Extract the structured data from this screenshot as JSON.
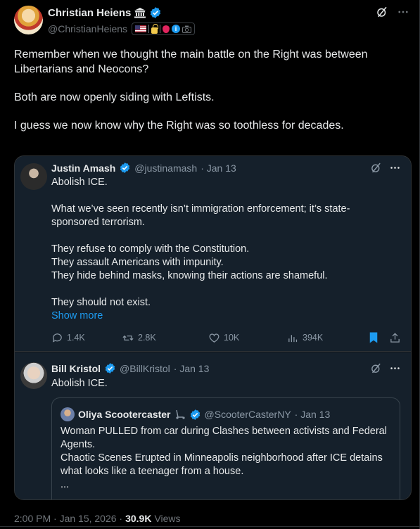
{
  "author": {
    "name": "Christian Heiens",
    "handle": "@ChristianHeiens"
  },
  "post_text": [
    "Remember when we thought the main battle on the Right was between Libertarians and Neocons?",
    "Both are now openly siding with Leftists.",
    "I guess we now know why the Right was so toothless for decades."
  ],
  "quote1": {
    "name": "Justin Amash",
    "handle": "@justinamash",
    "date": "· Jan 13",
    "body": [
      "Abolish ICE.",
      "What we’ve seen recently isn’t immigration enforcement; it’s state-sponsored terrorism.",
      "They refuse to comply with the Constitution.\nThey assault Americans with impunity.\nThey hide behind masks, knowing their actions are shameful.",
      "They should not exist."
    ],
    "show_more": "Show more",
    "stats": {
      "replies": "1.4K",
      "reposts": "2.8K",
      "likes": "10K",
      "views": "394K"
    }
  },
  "quote2": {
    "name": "Bill Kristol",
    "handle": "@BillKristol",
    "date": "· Jan 13",
    "body": "Abolish ICE.",
    "inner": {
      "name": "Oliya Scootercaster",
      "handle": "@ScooterCasterNY",
      "date": "· Jan 13",
      "body": "Woman PULLED from car during Clashes between activists and Federal Agents.\nChaotic Scenes Erupted in Minneapolis neighborhood after ICE detains what looks like a teenager from a house.\n..."
    }
  },
  "footer": {
    "time": "2:00 PM · Jan 15, 2026 ·",
    "views_count": "30.9K",
    "views_label": "Views"
  },
  "colors": {
    "accent": "#1d9bf0",
    "background": "#000000",
    "card": "#15202b",
    "muted": "#71767b"
  },
  "icons": [
    "verified-badge-icon",
    "government-icon",
    "grok-icon",
    "more-icon",
    "reply-icon",
    "repost-icon",
    "like-icon",
    "views-icon",
    "bookmark-icon",
    "share-icon"
  ]
}
